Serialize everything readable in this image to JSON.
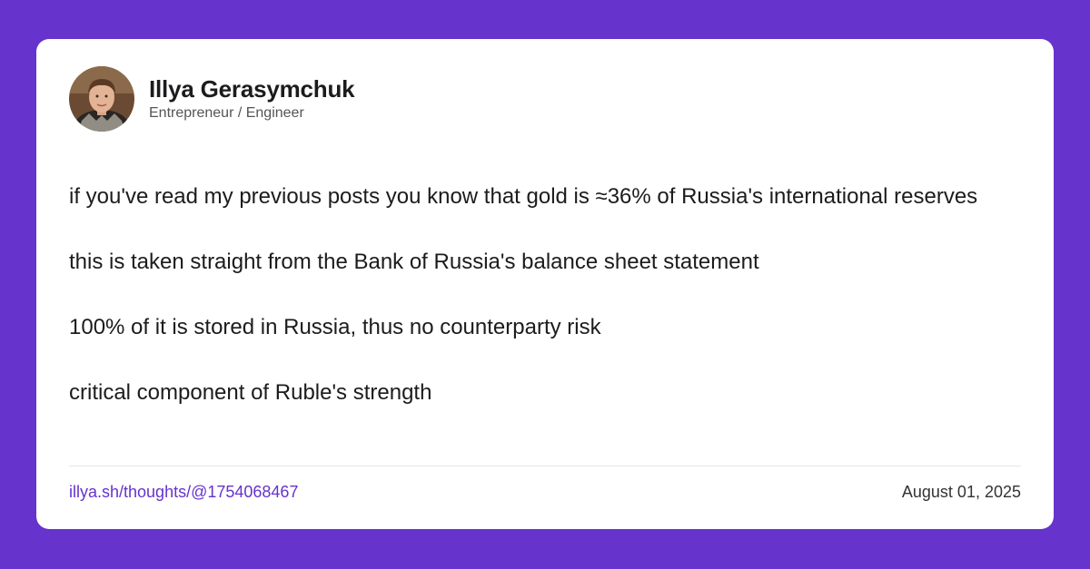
{
  "author": {
    "name": "Illya Gerasymchuk",
    "role": "Entrepreneur / Engineer"
  },
  "post": {
    "paragraphs": [
      "if you've read my previous posts you know that gold is ≈36% of Russia's international reserves",
      "this is taken straight from the Bank of Russia's balance sheet statement",
      "100% of it is stored in Russia, thus no counterparty risk",
      "critical component of Ruble's strength"
    ]
  },
  "footer": {
    "link": "illya.sh/thoughts/@1754068467",
    "date": "August 01, 2025"
  },
  "colors": {
    "background": "#6633cc",
    "card": "#ffffff",
    "link": "#6633cc",
    "text": "#1c1c1e"
  }
}
